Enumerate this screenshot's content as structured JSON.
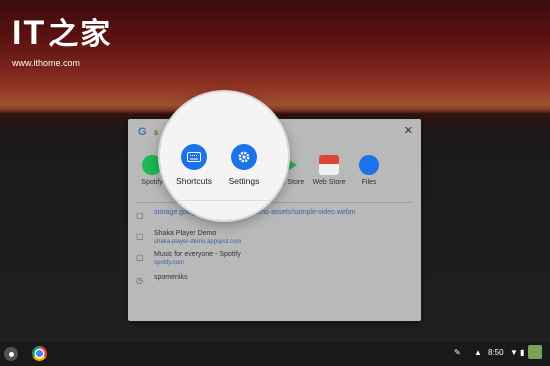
{
  "watermark": {
    "brand": "IT",
    "brand_cjk": "之家",
    "url": "www.ithome.com"
  },
  "search": {
    "query": "s"
  },
  "apps": [
    {
      "label": "Spotify",
      "icon": "spotify-icon",
      "color": "#1db954"
    },
    {
      "label": "Play Store",
      "icon": "play-store-icon",
      "color": "#34a853"
    },
    {
      "label": "Web Store",
      "icon": "web-store-icon",
      "color": "#db4437"
    },
    {
      "label": "Files",
      "icon": "files-icon",
      "color": "#1a73e8"
    }
  ],
  "magnified_apps": [
    {
      "label": "Shortcuts",
      "icon": "keyboard-icon"
    },
    {
      "label": "Settings",
      "icon": "gear-icon"
    }
  ],
  "results": [
    {
      "title": "storage.googleapis.com/shaka-demo-assets/sample-video.webm",
      "icon": "file-icon"
    },
    {
      "title": "Shaka Player Demo",
      "subtitle": "shaka-player-demo.appspot.com",
      "icon": "file-icon"
    },
    {
      "title": "Music for everyone - Spotify",
      "subtitle": "spotify.com",
      "icon": "file-icon"
    },
    {
      "title": "spomeniks",
      "icon": "history-icon"
    }
  ],
  "tray": {
    "time": "8:50"
  },
  "colors": {
    "accent": "#1a73e8",
    "link": "#3b63a8"
  }
}
